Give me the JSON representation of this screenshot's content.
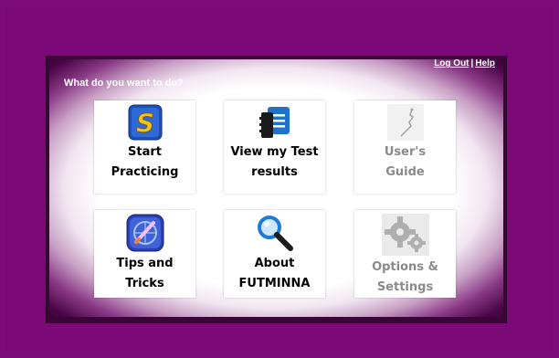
{
  "header": {
    "logout_label": "Log Out",
    "separator": "|",
    "help_label": "Help",
    "prompt": "What do you want to do?"
  },
  "tiles": [
    {
      "line1": "Start",
      "line2": "Practicing",
      "icon": "start-practicing-icon",
      "enabled": true
    },
    {
      "line1": "View my Test",
      "line2": "results",
      "icon": "test-results-icon",
      "enabled": true
    },
    {
      "line1": "User's",
      "line2": "Guide",
      "icon": "users-guide-icon",
      "enabled": false
    },
    {
      "line1": "Tips and",
      "line2": "Tricks",
      "icon": "tips-tricks-icon",
      "enabled": true
    },
    {
      "line1": "About",
      "line2": "FUTMINNA",
      "icon": "magnifier-icon",
      "enabled": true
    },
    {
      "line1": "Options &",
      "line2": "Settings",
      "icon": "gear-icon",
      "enabled": false
    }
  ],
  "colors": {
    "background": "#7c0c78",
    "panel": "#3a0537",
    "disabled_text": "#8a8a8a"
  }
}
